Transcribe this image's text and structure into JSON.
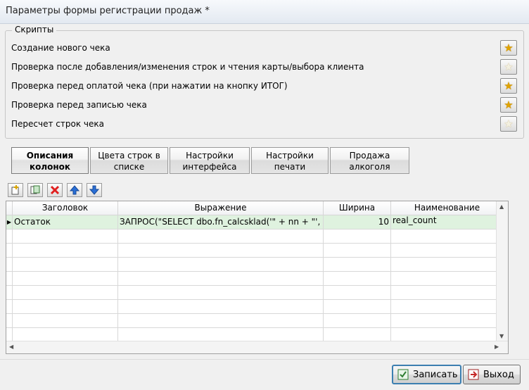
{
  "window": {
    "title": "Параметры формы регистрации продаж *"
  },
  "scripts_group": {
    "label": "Скрипты",
    "items": [
      {
        "label": "Создание нового чека",
        "star": "filled"
      },
      {
        "label": "Проверка после добавления/изменения строк и чтения карты/выбора клиента",
        "star": "empty"
      },
      {
        "label": "Проверка перед оплатой чека (при нажатии на кнопку ИТОГ)",
        "star": "filled"
      },
      {
        "label": "Проверка перед записью чека",
        "star": "filled"
      },
      {
        "label": "Пересчет строк чека",
        "star": "empty"
      }
    ]
  },
  "tabs": [
    {
      "line1": "Описания",
      "line2": "колонок",
      "active": true
    },
    {
      "line1": "Цвета строк в",
      "line2": "списке",
      "active": false
    },
    {
      "line1": "Настройки",
      "line2": "интерфейса",
      "active": false
    },
    {
      "line1": "Настройки",
      "line2": "печати",
      "active": false
    },
    {
      "line1": "Продажа",
      "line2": "алкоголя",
      "active": false
    }
  ],
  "toolbar": {
    "icons": [
      "add-row-icon",
      "edit-row-icon",
      "delete-row-icon",
      "move-up-icon",
      "move-down-icon"
    ]
  },
  "grid": {
    "columns": [
      "Заголовок",
      "Выражение",
      "Ширина",
      "Наименование"
    ],
    "rows": [
      {
        "title": "Остаток",
        "expression": "ЗАПРОС(\"SELECT dbo.fn_calcsklad('\" + nn + \"',",
        "width": "10",
        "name": "real_count"
      }
    ]
  },
  "buttons": {
    "save": "Записать",
    "exit": "Выход"
  },
  "colors": {
    "selected_row": "#dff2df",
    "star": "#e0a300",
    "delete": "#e02020",
    "arrows": "#2a6fd6"
  }
}
